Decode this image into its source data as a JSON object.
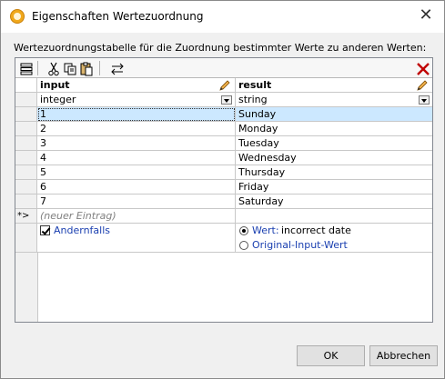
{
  "window": {
    "title": "Eigenschaften Wertezuordnung",
    "close_icon": "close-x-icon"
  },
  "description": "Wertezuordnungstabelle für die Zuordnung bestimmter Werte zu anderen Werten:",
  "toolbar": {
    "buttons": [
      "insert-row-icon",
      "cut-icon",
      "copy-icon",
      "paste-icon",
      "swap-columns-icon",
      "delete-icon"
    ]
  },
  "table": {
    "columns": [
      {
        "header": "input",
        "type": "integer"
      },
      {
        "header": "result",
        "type": "string"
      }
    ],
    "rows": [
      {
        "input": "1",
        "result": "Sunday"
      },
      {
        "input": "2",
        "result": "Monday"
      },
      {
        "input": "3",
        "result": "Tuesday"
      },
      {
        "input": "4",
        "result": "Wednesday"
      },
      {
        "input": "5",
        "result": "Thursday"
      },
      {
        "input": "6",
        "result": "Friday"
      },
      {
        "input": "7",
        "result": "Saturday"
      }
    ],
    "new_entry_marker": "*>",
    "new_entry_label": "(neuer Eintrag)",
    "otherwise": {
      "checkbox_label": "Andernfalls",
      "checked": true,
      "option_value_label": "Wert:",
      "option_value_text": "incorrect date",
      "option_original_label": "Original-Input-Wert",
      "selected_option": "Wert"
    }
  },
  "buttons": {
    "ok": "OK",
    "cancel": "Abbrechen"
  },
  "colors": {
    "selection": "#cce8ff",
    "link": "#1a3fb0",
    "delete_icon": "#c00000"
  }
}
